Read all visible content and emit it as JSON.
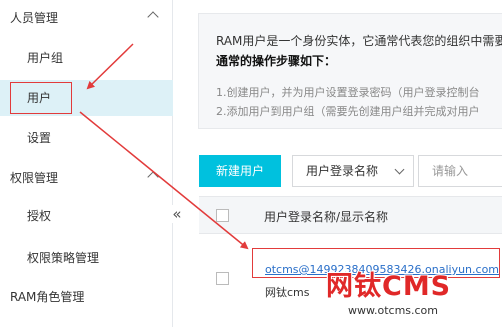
{
  "sidebar": {
    "group_people": "人员管理",
    "item_user_groups": "用户组",
    "item_users": "用户",
    "item_settings": "设置",
    "group_permissions": "权限管理",
    "item_authorization": "授权",
    "item_policy_management": "权限策略管理",
    "group_ram_roles": "RAM角色管理",
    "collapse_glyph": "«",
    "active_background": "#ddf1f7"
  },
  "info": {
    "description": "RAM用户是一个身份实体，它通常代表您的组织中需要",
    "steps_title": "通常的操作步骤如下：",
    "step1": "1.创建用户，并为用户设置登录密码（用户登录控制台",
    "step2": "2.添加用户到用户组（需要先创建用户组并完成对用户"
  },
  "toolbar": {
    "new_user_label": "新建用户",
    "search_field_label": "用户登录名称",
    "search_placeholder": "请输入",
    "accent_color": "#00c1de"
  },
  "table": {
    "header_column": "用户登录名称/显示名称",
    "rows": [
      {
        "login_name": "otcms@1499238409583426.onaliyun.com",
        "display_name": "网钛cms"
      }
    ]
  },
  "annotation": {
    "highlight_color": "#e23b3b"
  },
  "watermark": {
    "brand": "网钛CMS",
    "url": "www.otcms.com"
  },
  "icons": [
    "chevron-up-icon",
    "chevron-down-icon",
    "collapse-icon",
    "arrow-annotation"
  ]
}
